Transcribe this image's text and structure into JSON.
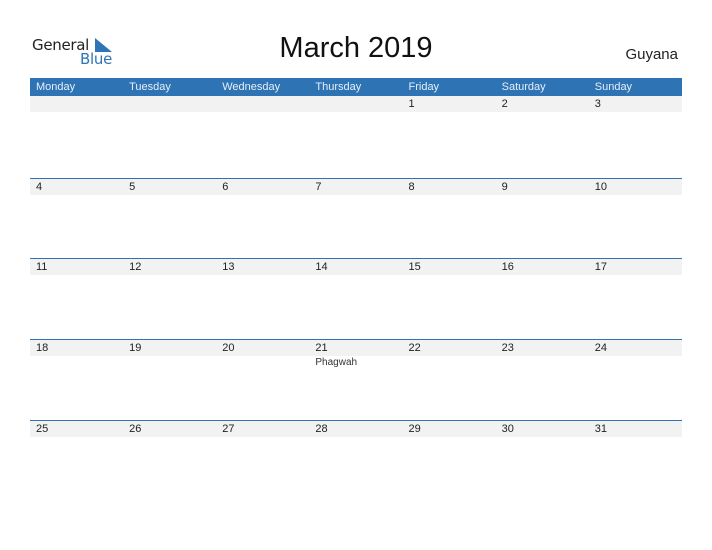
{
  "logo": {
    "word1": "General",
    "word2": "Blue"
  },
  "title": "March 2019",
  "country": "Guyana",
  "colors": {
    "accent": "#2e74b5",
    "strip": "#f2f2f2"
  },
  "weekdays": [
    "Monday",
    "Tuesday",
    "Wednesday",
    "Thursday",
    "Friday",
    "Saturday",
    "Sunday"
  ],
  "weeks": [
    {
      "days": [
        {
          "n": "",
          "e": ""
        },
        {
          "n": "",
          "e": ""
        },
        {
          "n": "",
          "e": ""
        },
        {
          "n": "",
          "e": ""
        },
        {
          "n": "1",
          "e": ""
        },
        {
          "n": "2",
          "e": ""
        },
        {
          "n": "3",
          "e": ""
        }
      ]
    },
    {
      "days": [
        {
          "n": "4",
          "e": ""
        },
        {
          "n": "5",
          "e": ""
        },
        {
          "n": "6",
          "e": ""
        },
        {
          "n": "7",
          "e": ""
        },
        {
          "n": "8",
          "e": ""
        },
        {
          "n": "9",
          "e": ""
        },
        {
          "n": "10",
          "e": ""
        }
      ]
    },
    {
      "days": [
        {
          "n": "11",
          "e": ""
        },
        {
          "n": "12",
          "e": ""
        },
        {
          "n": "13",
          "e": ""
        },
        {
          "n": "14",
          "e": ""
        },
        {
          "n": "15",
          "e": ""
        },
        {
          "n": "16",
          "e": ""
        },
        {
          "n": "17",
          "e": ""
        }
      ]
    },
    {
      "days": [
        {
          "n": "18",
          "e": ""
        },
        {
          "n": "19",
          "e": ""
        },
        {
          "n": "20",
          "e": ""
        },
        {
          "n": "21",
          "e": "Phagwah"
        },
        {
          "n": "22",
          "e": ""
        },
        {
          "n": "23",
          "e": ""
        },
        {
          "n": "24",
          "e": ""
        }
      ]
    },
    {
      "days": [
        {
          "n": "25",
          "e": ""
        },
        {
          "n": "26",
          "e": ""
        },
        {
          "n": "27",
          "e": ""
        },
        {
          "n": "28",
          "e": ""
        },
        {
          "n": "29",
          "e": ""
        },
        {
          "n": "30",
          "e": ""
        },
        {
          "n": "31",
          "e": ""
        }
      ]
    }
  ]
}
